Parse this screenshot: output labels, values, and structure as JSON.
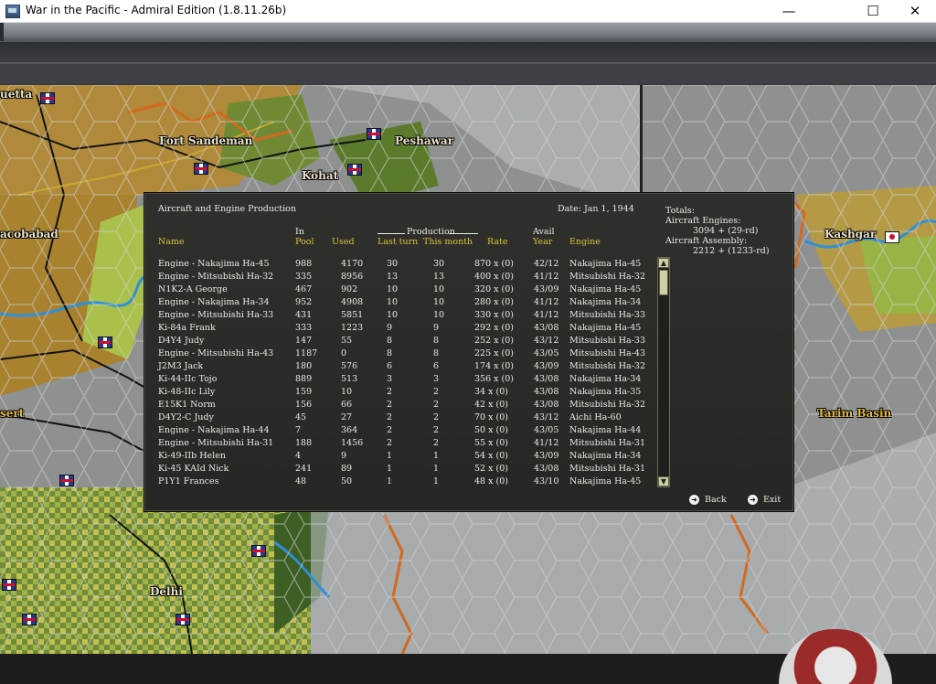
{
  "window": {
    "title": "War in the Pacific - Admiral Edition (1.8.11.26b)",
    "minimize": "—",
    "maximize": "☐",
    "close": "✕"
  },
  "map": {
    "labels": [
      {
        "text": "uetta",
        "style": "white"
      },
      {
        "text": "Fort Sandeman",
        "style": "white"
      },
      {
        "text": "Peshawar",
        "style": "white"
      },
      {
        "text": "Kohat",
        "style": "white"
      },
      {
        "text": "acobabad",
        "style": "white"
      },
      {
        "text": "Kashgar",
        "style": "white"
      },
      {
        "text": "sert",
        "style": "gold"
      },
      {
        "text": "Tarim Basin",
        "style": "gold"
      },
      {
        "text": "Delhi",
        "style": "white"
      }
    ]
  },
  "dialog": {
    "title": "Aircraft and Engine Production",
    "date": "Date: Jan 1, 1944",
    "totals": {
      "heading": "Totals:",
      "engines_label": "Aircraft Engines:",
      "engines_value": "3094 + (29-rd)",
      "assembly_label": "Aircraft Assembly:",
      "assembly_value": "2212 + (1233-rd)"
    },
    "headers": {
      "name": "Name",
      "in": "In",
      "pool": "Pool",
      "used": "Used",
      "production": "Production",
      "last_turn": "Last turn",
      "this_month": "This month",
      "rate": "Rate",
      "avail": "Avail",
      "year": "Year",
      "engine": "Engine"
    },
    "rows": [
      {
        "name": "Engine - Nakajima Ha-45",
        "pool": "988",
        "used": "4170",
        "last": "30",
        "this": "30",
        "rate": "870 x (0)",
        "year": "42/12",
        "engine": "Nakajima Ha-45"
      },
      {
        "name": "Engine - Mitsubishi Ha-32",
        "pool": "335",
        "used": "8956",
        "last": "13",
        "this": "13",
        "rate": "400 x (0)",
        "year": "41/12",
        "engine": "Mitsubishi Ha-32"
      },
      {
        "name": "N1K2-A George",
        "pool": "467",
        "used": "902",
        "last": "10",
        "this": "10",
        "rate": "320 x (0)",
        "year": "43/09",
        "engine": "Nakajima Ha-45"
      },
      {
        "name": "Engine - Nakajima Ha-34",
        "pool": "952",
        "used": "4908",
        "last": "10",
        "this": "10",
        "rate": "280 x (0)",
        "year": "41/12",
        "engine": "Nakajima Ha-34"
      },
      {
        "name": "Engine - Mitsubishi Ha-33",
        "pool": "431",
        "used": "5851",
        "last": "10",
        "this": "10",
        "rate": "330 x (0)",
        "year": "41/12",
        "engine": "Mitsubishi Ha-33"
      },
      {
        "name": "Ki-84a Frank",
        "pool": "333",
        "used": "1223",
        "last": "9",
        "this": "9",
        "rate": "292 x (0)",
        "year": "43/08",
        "engine": "Nakajima Ha-45"
      },
      {
        "name": "D4Y4 Judy",
        "pool": "147",
        "used": "55",
        "last": "8",
        "this": "8",
        "rate": "252 x (0)",
        "year": "43/12",
        "engine": "Mitsubishi Ha-33"
      },
      {
        "name": "Engine - Mitsubishi Ha-43",
        "pool": "1187",
        "used": "0",
        "last": "8",
        "this": "8",
        "rate": "225 x (0)",
        "year": "43/05",
        "engine": "Mitsubishi Ha-43"
      },
      {
        "name": "J2M3 Jack",
        "pool": "180",
        "used": "576",
        "last": "6",
        "this": "6",
        "rate": "174 x (0)",
        "year": "43/09",
        "engine": "Mitsubishi Ha-32"
      },
      {
        "name": "Ki-44-IIc Tojo",
        "pool": "889",
        "used": "513",
        "last": "3",
        "this": "3",
        "rate": "356 x (0)",
        "year": "43/08",
        "engine": "Nakajima Ha-34"
      },
      {
        "name": "Ki-48-IIc Lily",
        "pool": "159",
        "used": "10",
        "last": "2",
        "this": "2",
        "rate": "34 x (0)",
        "year": "43/08",
        "engine": "Nakajima Ha-35"
      },
      {
        "name": "E15K1 Norm",
        "pool": "156",
        "used": "66",
        "last": "2",
        "this": "2",
        "rate": "42 x (0)",
        "year": "43/08",
        "engine": "Mitsubishi Ha-32"
      },
      {
        "name": "D4Y2-C Judy",
        "pool": "45",
        "used": "27",
        "last": "2",
        "this": "2",
        "rate": "70 x (0)",
        "year": "43/12",
        "engine": "Aichi Ha-60"
      },
      {
        "name": "Engine - Nakajima Ha-44",
        "pool": "7",
        "used": "364",
        "last": "2",
        "this": "2",
        "rate": "50 x (0)",
        "year": "43/05",
        "engine": "Nakajima Ha-44"
      },
      {
        "name": "Engine - Mitsubishi Ha-31",
        "pool": "188",
        "used": "1456",
        "last": "2",
        "this": "2",
        "rate": "55 x (0)",
        "year": "41/12",
        "engine": "Mitsubishi Ha-31"
      },
      {
        "name": "Ki-49-IIb Helen",
        "pool": "4",
        "used": "9",
        "last": "1",
        "this": "1",
        "rate": "54 x (0)",
        "year": "43/09",
        "engine": "Nakajima Ha-34"
      },
      {
        "name": "Ki-45 KAId Nick",
        "pool": "241",
        "used": "89",
        "last": "1",
        "this": "1",
        "rate": "52 x (0)",
        "year": "43/08",
        "engine": "Mitsubishi Ha-31"
      },
      {
        "name": "P1Y1 Frances",
        "pool": "48",
        "used": "50",
        "last": "1",
        "this": "1",
        "rate": "48 x (0)",
        "year": "43/10",
        "engine": "Nakajima Ha-45"
      }
    ],
    "back": "Back",
    "exit": "Exit"
  }
}
